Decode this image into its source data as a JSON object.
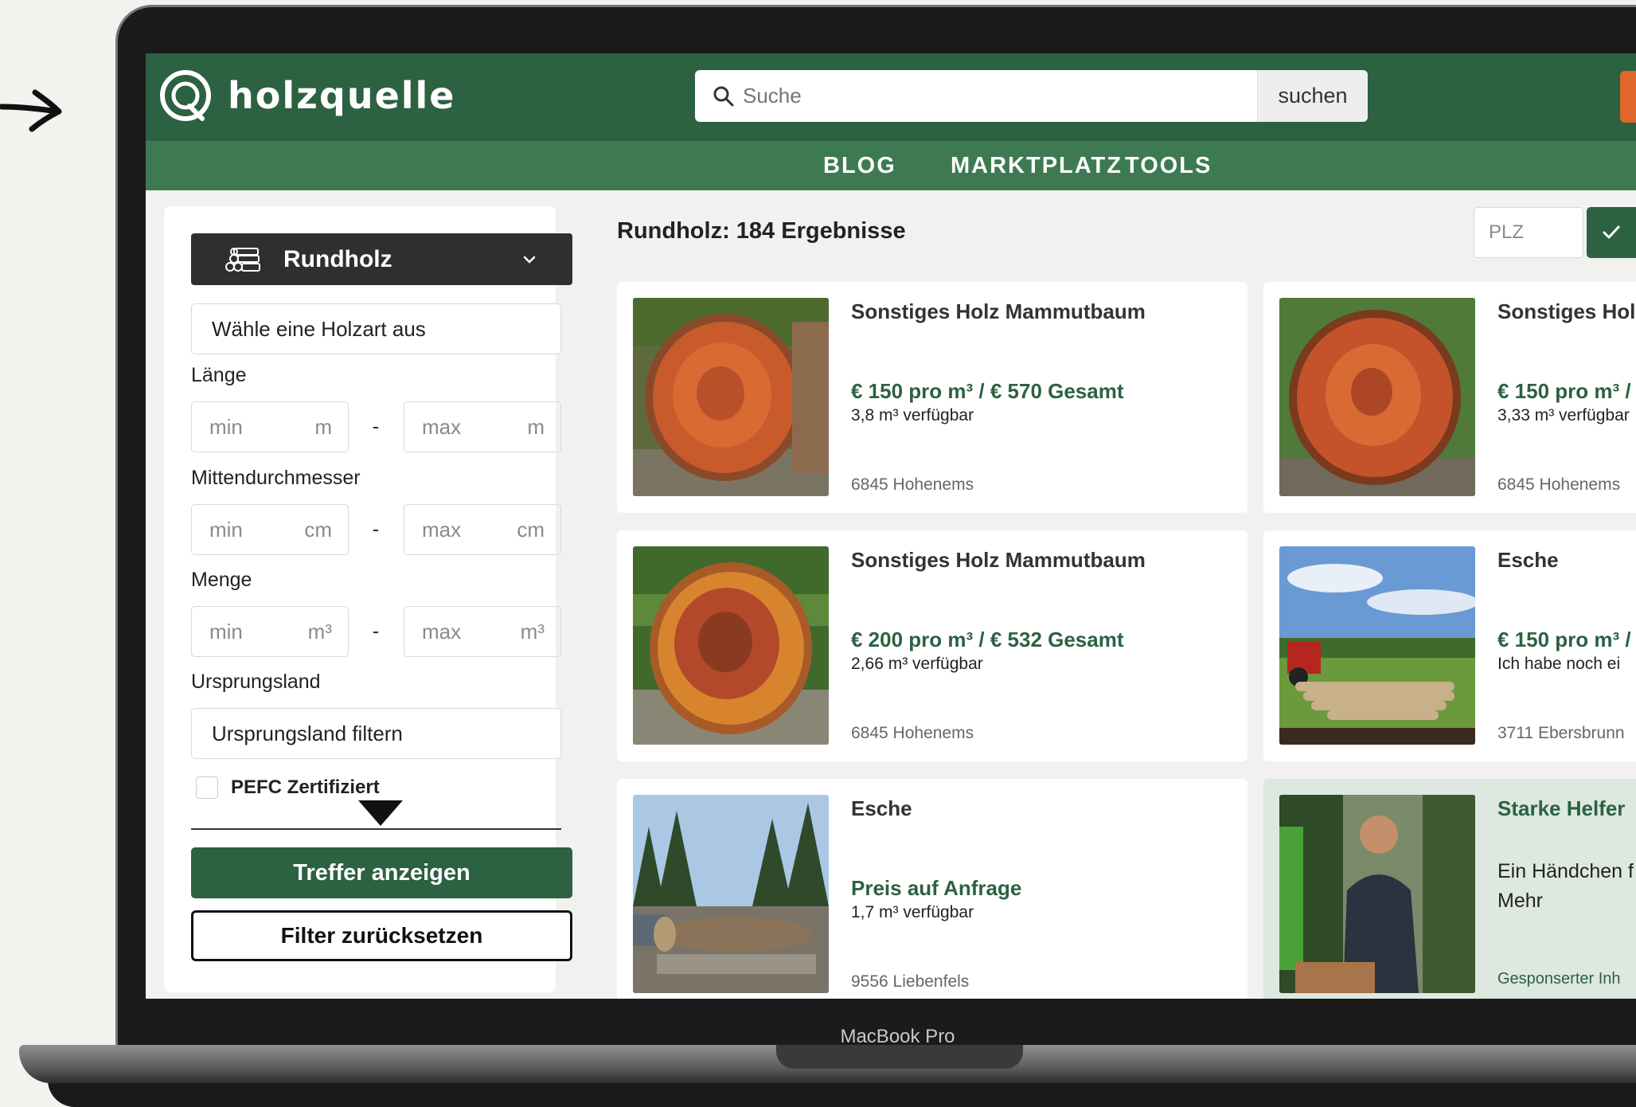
{
  "device": {
    "label": "MacBook Pro"
  },
  "header": {
    "brand": "holzquelle",
    "search": {
      "placeholder": "Suche",
      "button": "suchen"
    },
    "nav": [
      "BLOG",
      "MARKTPLATZ",
      "TOOLS"
    ]
  },
  "filters": {
    "category": "Rundholz",
    "wood_type_placeholder": "Wähle eine Holzart aus",
    "length": {
      "label": "Länge",
      "min": "min",
      "max": "max",
      "unit": "m"
    },
    "diameter": {
      "label": "Mittendurchmesser",
      "min": "min",
      "max": "max",
      "unit": "cm"
    },
    "quantity": {
      "label": "Menge",
      "min": "min",
      "max": "max",
      "unit": "m³"
    },
    "origin": {
      "label": "Ursprungsland",
      "placeholder": "Ursprungsland filtern"
    },
    "pefc_label": "PEFC Zertifiziert",
    "show_button": "Treffer anzeigen",
    "reset_button": "Filter zurücksetzen"
  },
  "results": {
    "title": "Rundholz: 184 Ergebnisse",
    "plz_placeholder": "PLZ",
    "cards": [
      {
        "title": "Sonstiges Holz Mammutbaum",
        "price": "€ 150 pro m³ / € 570 Gesamt",
        "availability": "3,8 m³ verfügbar",
        "location": "6845 Hohenems"
      },
      {
        "title": "Sonstiges Holz",
        "price": "€ 150 pro m³ / ",
        "availability": "3,33 m³ verfügbar",
        "location": "6845 Hohenems"
      },
      {
        "title": "Sonstiges Holz Mammutbaum",
        "price": "€ 200 pro m³ / € 532 Gesamt",
        "availability": "2,66 m³ verfügbar",
        "location": "6845 Hohenems"
      },
      {
        "title": "Esche",
        "price": "€ 150 pro m³ / ",
        "availability": "Ich habe noch ei",
        "location": "3711 Ebersbrunn"
      },
      {
        "title": "Esche",
        "price": "Preis auf Anfrage",
        "availability": "1,7 m³ verfügbar",
        "location": "9556 Liebenfels"
      }
    ],
    "sponsored": {
      "title": "Starke Helfer",
      "text": "Ein Händchen f die passenden machen! Mehr",
      "tag": "Gesponserter Inh"
    }
  },
  "colors": {
    "brand_green": "#2c6142",
    "nav_green": "#3d7a52",
    "accent_orange": "#e0672c"
  }
}
